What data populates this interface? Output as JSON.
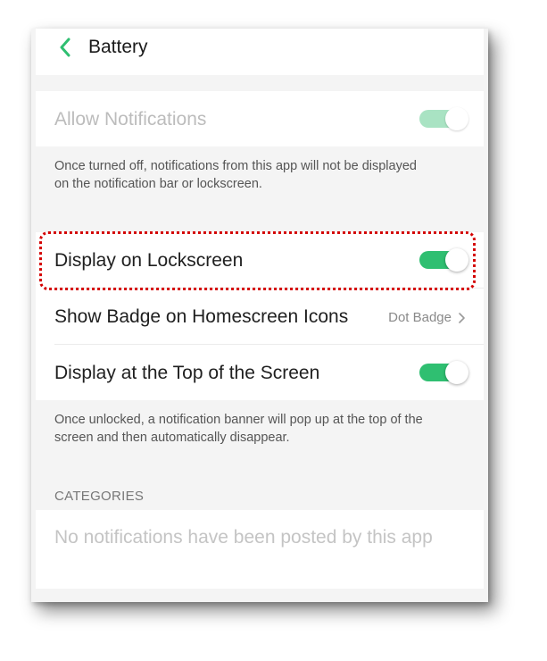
{
  "header": {
    "title": "Battery",
    "back_icon": "chevron-left-icon"
  },
  "allow_notifications": {
    "label": "Allow Notifications",
    "enabled": true,
    "disabled_state": true
  },
  "allow_description": "Once turned off, notifications from this app will not be displayed on the notification bar or lockscreen.",
  "settings": {
    "lockscreen": {
      "label": "Display on Lockscreen",
      "enabled": true
    },
    "badge": {
      "label": "Show Badge on Homescreen Icons",
      "value": "Dot Badge"
    },
    "top_screen": {
      "label": "Display at the Top of the Screen",
      "enabled": true
    }
  },
  "banner_description": "Once unlocked, a notification banner will pop up at the top of the screen and then automatically disappear.",
  "categories": {
    "header": "CATEGORIES",
    "empty_text": "No notifications have been posted by this app"
  },
  "colors": {
    "accent": "#2fbf71",
    "accent_disabled": "#a9e3c3",
    "highlight": "#d40000",
    "background": "#f4f4f4"
  }
}
